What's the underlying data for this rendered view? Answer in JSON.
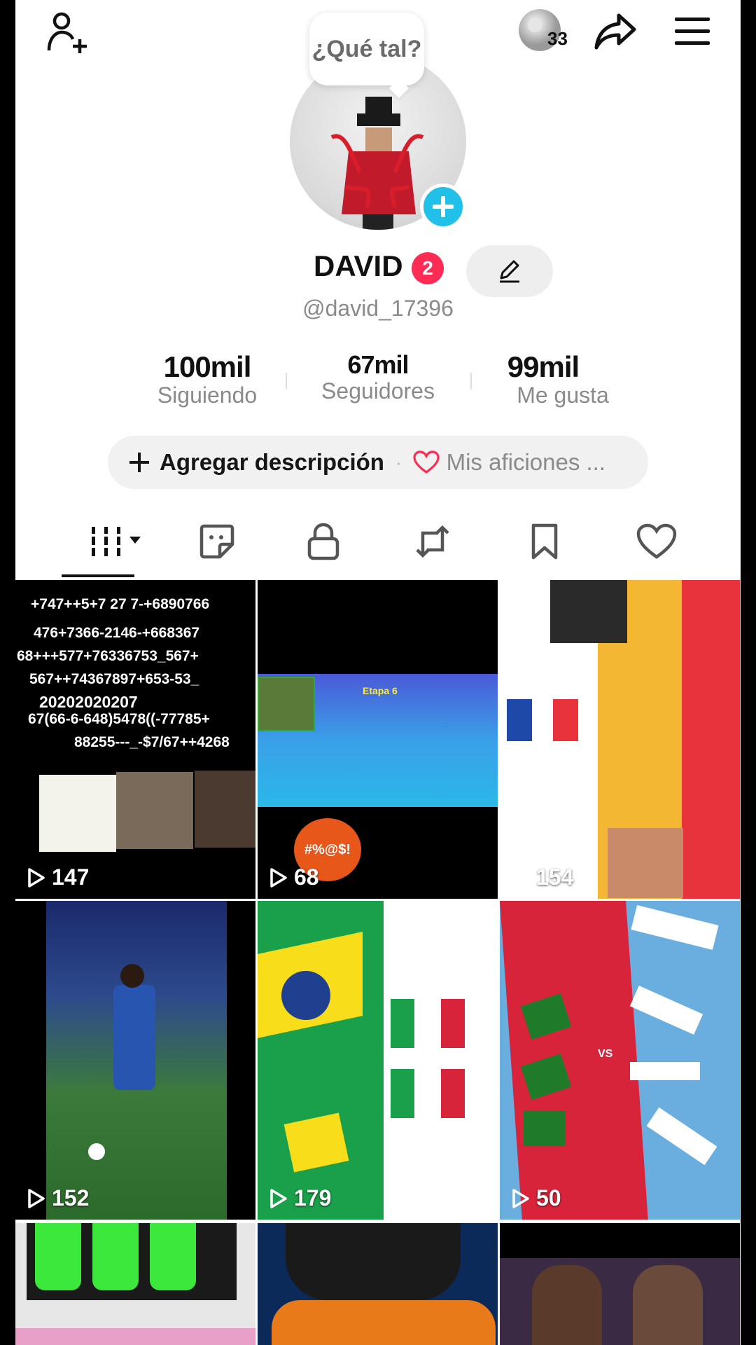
{
  "header": {
    "add_friend_icon": "person-plus-icon",
    "notification_count": "33",
    "share_icon": "share-arrow-icon",
    "menu_icon": "hamburger-menu-icon"
  },
  "profile": {
    "bubble_text": "¿Qué tal?",
    "display_name": "DAVID",
    "badge_count": "2",
    "handle": "@david_17396"
  },
  "stats": [
    {
      "value": "100mil",
      "label": "Siguiendo"
    },
    {
      "value": "67mil",
      "label": "Seguidores"
    },
    {
      "value": "99mil",
      "label": "Me gusta"
    }
  ],
  "description": {
    "add_label": "Agregar descripción",
    "separator": "·",
    "hobbies_label": "Mis aficiones ..."
  },
  "tabs": [
    "videos-grid-icon",
    "sticker-icon",
    "lock-icon",
    "repost-icon",
    "bookmark-icon",
    "heart-icon"
  ],
  "videos": [
    {
      "views": "147",
      "text_lines": [
        "+747++5+7 27 7-+6890766",
        "476+7366-2146-+668367",
        "68+++577+76336753_567+",
        "567++74367897+653-53_",
        "20202020207",
        "67(66-6-648)5478((-77785+",
        "88255---_-$7/67++4268"
      ]
    },
    {
      "views": "68",
      "overlay_text": "Etapa 6",
      "emoji_text": "#%@$!"
    },
    {
      "views": "154"
    },
    {
      "views": "152"
    },
    {
      "views": "179"
    },
    {
      "views": "50",
      "vs_text": "VS"
    },
    {
      "views": ""
    },
    {
      "views": ""
    },
    {
      "views": ""
    }
  ],
  "colors": {
    "accent": "#fe2c55",
    "badge_blue": "#20c0e8"
  }
}
